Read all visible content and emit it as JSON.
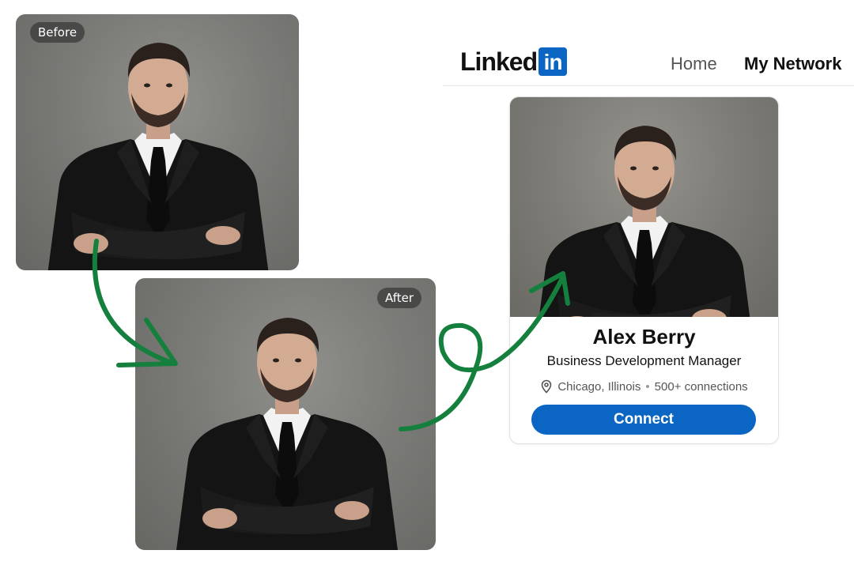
{
  "before_photo": {
    "badge": "Before"
  },
  "after_photo": {
    "badge": "After"
  },
  "linkedin": {
    "logo_text": "Linked",
    "logo_box_text": "in",
    "nav": {
      "home": "Home",
      "my_network": "My Network"
    }
  },
  "profile": {
    "name": "Alex Berry",
    "headline": "Business Development Manager",
    "location": "Chicago, Illinois",
    "separator": "•",
    "connections": "500+ connections",
    "connect_label": "Connect"
  },
  "colors": {
    "linkedin_blue": "#0a66c2",
    "arrow_green": "#15803d",
    "badge_bg": "#3c3c3c"
  },
  "icons": [
    "location-pin-icon",
    "curved-arrow-icon"
  ]
}
